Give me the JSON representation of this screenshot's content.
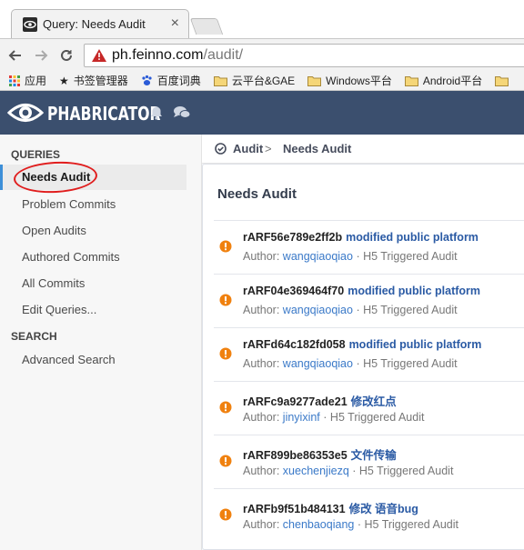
{
  "browser": {
    "tab_title": "Query: Needs Audit",
    "tab_close": "×",
    "url_host": "ph.feinno.com",
    "url_path": "/audit/",
    "bookmarks": [
      "应用",
      "书签管理器",
      "百度词典",
      "云平台&GAE",
      "Windows平台",
      "Android平台"
    ]
  },
  "header": {
    "app_name": "PHABRICATOR",
    "bg_color": "#3b4f6e"
  },
  "sidebar": {
    "queries_heading": "QUERIES",
    "items": [
      {
        "label": "Needs Audit",
        "active": true
      },
      {
        "label": "Problem Commits"
      },
      {
        "label": "Open Audits"
      },
      {
        "label": "Authored Commits"
      },
      {
        "label": "All Commits"
      },
      {
        "label": "Edit Queries..."
      }
    ],
    "search_heading": "SEARCH",
    "search_items": [
      {
        "label": "Advanced Search"
      }
    ]
  },
  "breadcrumb": {
    "root": "Audit",
    "separator": ">",
    "current": "Needs Audit"
  },
  "main": {
    "title": "Needs Audit",
    "status_color": "#f0810f",
    "commits": [
      {
        "id": "rARF56e789e2ff2b",
        "summary": "modified public platform",
        "author_label": "Author:",
        "author": "wangqiaoqiao",
        "trigger": "· H5 Triggered Audit"
      },
      {
        "id": "rARF04e369464f70",
        "summary": "modified public platform",
        "author_label": "Author:",
        "author": "wangqiaoqiao",
        "trigger": "· H5 Triggered Audit"
      },
      {
        "id": "rARFd64c182fd058",
        "summary": "modified public platform",
        "author_label": "Author:",
        "author": "wangqiaoqiao",
        "trigger": "· H5 Triggered Audit"
      },
      {
        "id": "rARFc9a9277ade21",
        "summary": "修改红点",
        "author_label": "Author:",
        "author": "jinyixinf",
        "trigger": "· H5 Triggered Audit"
      },
      {
        "id": "rARF899be86353e5",
        "summary": "文件传输",
        "author_label": "Author:",
        "author": "xuechenjiezq",
        "trigger": "· H5 Triggered Audit"
      },
      {
        "id": "rARFb9f51b484131",
        "summary": "修改 语音bug",
        "author_label": "Author:",
        "author": "chenbaoqiang",
        "trigger": "· H5 Triggered Audit"
      }
    ]
  }
}
